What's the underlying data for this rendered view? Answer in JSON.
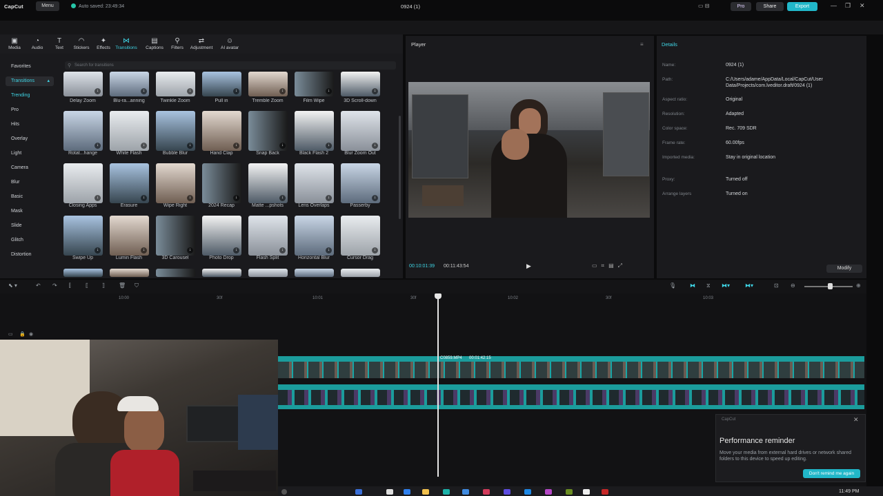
{
  "titlebar": {
    "logo": "CapCut",
    "menu": "Menu",
    "autosave": "Auto saved: 23:49:34",
    "project": "0924 (1)",
    "pro": "Pro",
    "share": "Share",
    "export": "Export"
  },
  "toolbar": [
    {
      "label": "Media",
      "icon": "media-icon",
      "glyph": "▣"
    },
    {
      "label": "Audio",
      "icon": "audio-icon",
      "glyph": "◔"
    },
    {
      "label": "Text",
      "icon": "text-icon",
      "glyph": "T"
    },
    {
      "label": "Stickers",
      "icon": "stickers-icon",
      "glyph": "◠"
    },
    {
      "label": "Effects",
      "icon": "effects-icon",
      "glyph": "✦"
    },
    {
      "label": "Transitions",
      "icon": "transitions-icon",
      "glyph": "⋈"
    },
    {
      "label": "Captions",
      "icon": "captions-icon",
      "glyph": "▤"
    },
    {
      "label": "Filters",
      "icon": "filters-icon",
      "glyph": "⚲"
    },
    {
      "label": "Adjustment",
      "icon": "adjustment-icon",
      "glyph": "⇄"
    },
    {
      "label": "AI avatar",
      "icon": "ai-avatar-icon",
      "glyph": "☺"
    }
  ],
  "sidebar": {
    "favorites": "Favorites",
    "transitions": "Transitions",
    "items": [
      "Trending",
      "Pro",
      "Hits",
      "Overlay",
      "Light",
      "Camera",
      "Blur",
      "Basic",
      "Mask",
      "Slide",
      "Glitch",
      "Distortion"
    ]
  },
  "search": {
    "placeholder": "Search for transitions"
  },
  "transitions": {
    "row1": [
      "Delay Zoom",
      "Blu-ra...anning",
      "Twinkle Zoom",
      "Pull in",
      "Tremble Zoom",
      "Film Wipe",
      "3D Scroll-down"
    ],
    "row2": [
      "Rotat...hange",
      "White Flash",
      "Bubble Blur",
      "Hand Clap",
      "Snap Back",
      "Black Flash 2",
      "Blur Zoom Out"
    ],
    "row3": [
      "Closing Apps",
      "Erasure",
      "Wipe Right",
      "2024 Recap",
      "Matte ...pshots",
      "Lens Overlaps",
      "Passerby"
    ],
    "row4": [
      "Swipe Up",
      "Lumin Flash",
      "3D Carousel",
      "Photo Drop",
      "Flash Split",
      "Horizontal Blur",
      "Cursor Drag"
    ]
  },
  "player": {
    "title": "Player",
    "current": "00:10:01:39",
    "total": "00:11:43:54"
  },
  "details": {
    "title": "Details",
    "rows": [
      {
        "k": "Name:",
        "v": "0924 (1)"
      },
      {
        "k": "Path:",
        "v": "C:/Users/adame/AppData/Local/CapCut/User Data/Projects/com.lveditor.draft/0924 (1)"
      },
      {
        "k": "Aspect ratio:",
        "v": "Original"
      },
      {
        "k": "Resolution:",
        "v": "Adapted"
      },
      {
        "k": "Color space:",
        "v": "Rec. 709 SDR"
      },
      {
        "k": "Frame rate:",
        "v": "60.00fps"
      },
      {
        "k": "Imported media:",
        "v": "Stay in original location"
      },
      {
        "k": "Proxy:",
        "v": "Turned off"
      },
      {
        "k": "Arrange layers",
        "v": "Turned on"
      }
    ],
    "modify": "Modify"
  },
  "timeline": {
    "ruler": [
      "10:00",
      "30f",
      "10:01",
      "30f",
      "10:02",
      "30f",
      "10:03"
    ],
    "clip_name": "C0859.MP4",
    "clip_duration": "00:01:42:15"
  },
  "popup": {
    "source": "CapCut",
    "title": "Performance reminder",
    "body": "Move your media from external hard drives or network shared folders to this device to speed up editing.",
    "button": "Don't remind me again"
  },
  "taskbar": {
    "clock": "11:49 PM"
  },
  "colors": {
    "accent": "#3fd6e6",
    "export": "#21b7c9",
    "track": "#1b9c9c"
  }
}
